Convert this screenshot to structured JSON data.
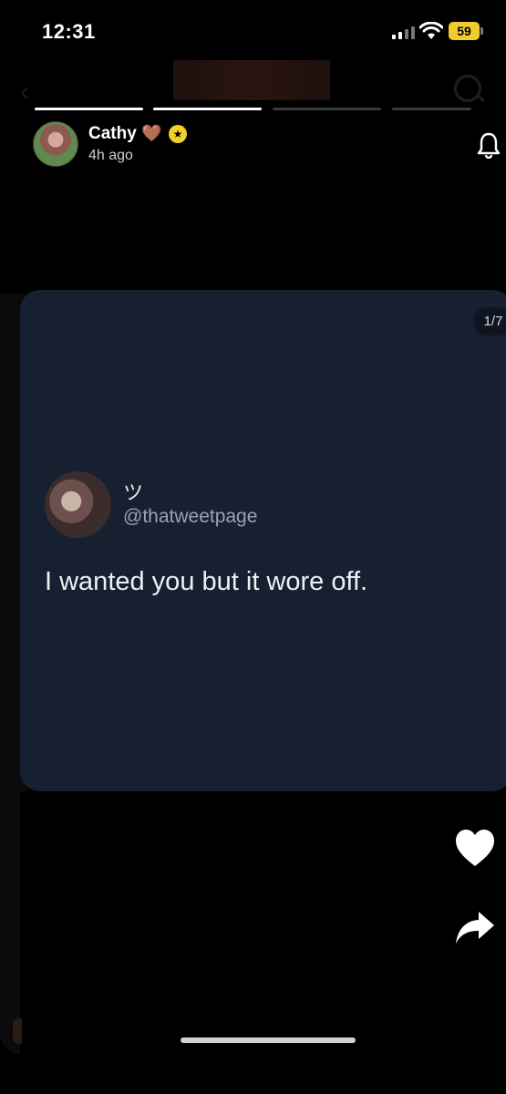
{
  "status_bar": {
    "time": "12:31",
    "battery": "59"
  },
  "header": {
    "username": "Cathy",
    "heart_emoji": "🤎",
    "post_time": "4h ago",
    "progress_segments": 4,
    "active_segments": 2
  },
  "card": {
    "page_indicator": "1/7",
    "tweet": {
      "display_name": "ツ",
      "handle": "@thatweetpage",
      "text": "I wanted you but it wore off."
    }
  },
  "actions": {
    "like_icon": "heart-icon",
    "share_icon": "share-arrow-icon"
  },
  "colors": {
    "card_bg": "#172030",
    "badge_yellow": "#f1d12c",
    "background": "#000000"
  }
}
